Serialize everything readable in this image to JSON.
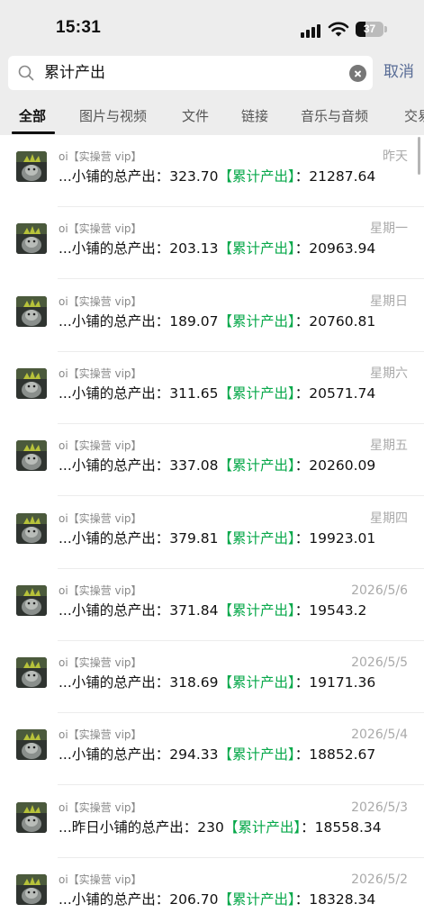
{
  "status_bar": {
    "time": "15:31",
    "battery": "37",
    "battery_level": 0.37
  },
  "search": {
    "query": "累计产出",
    "cancel_label": "取消"
  },
  "tabs": [
    {
      "label": "全部",
      "active": true
    },
    {
      "label": "图片与视频"
    },
    {
      "label": "文件"
    },
    {
      "label": "链接"
    },
    {
      "label": "音乐与音频"
    },
    {
      "label": "交易"
    }
  ],
  "results": [
    {
      "sender": "oi【实操营 vip】",
      "date": "昨天",
      "prefix": "...小铺的总产出：323.70",
      "highlight": "【累计产出】",
      "suffix": "：21287.64"
    },
    {
      "sender": "oi【实操营 vip】",
      "date": "星期一",
      "prefix": "...小铺的总产出：203.13",
      "highlight": "【累计产出】",
      "suffix": "：20963.94"
    },
    {
      "sender": "oi【实操营 vip】",
      "date": "星期日",
      "prefix": "...小铺的总产出：189.07",
      "highlight": "【累计产出】",
      "suffix": "：20760.81"
    },
    {
      "sender": "oi【实操营 vip】",
      "date": "星期六",
      "prefix": "...小铺的总产出：311.65",
      "highlight": "【累计产出】",
      "suffix": "：20571.74"
    },
    {
      "sender": "oi【实操营 vip】",
      "date": "星期五",
      "prefix": "...小铺的总产出：337.08",
      "highlight": "【累计产出】",
      "suffix": "：20260.09"
    },
    {
      "sender": "oi【实操营 vip】",
      "date": "星期四",
      "prefix": "...小铺的总产出：379.81",
      "highlight": "【累计产出】",
      "suffix": "：19923.01"
    },
    {
      "sender": "oi【实操营 vip】",
      "date": "2026/5/6",
      "prefix": "...小铺的总产出：371.84",
      "highlight": "【累计产出】",
      "suffix": "：19543.2"
    },
    {
      "sender": "oi【实操营 vip】",
      "date": "2026/5/5",
      "prefix": "...小铺的总产出：318.69",
      "highlight": "【累计产出】",
      "suffix": "：19171.36"
    },
    {
      "sender": "oi【实操营 vip】",
      "date": "2026/5/4",
      "prefix": "...小铺的总产出：294.33",
      "highlight": "【累计产出】",
      "suffix": "：18852.67"
    },
    {
      "sender": "oi【实操营 vip】",
      "date": "2026/5/3",
      "prefix": "...昨日小铺的总产出：230",
      "highlight": "【累计产出】",
      "suffix": "：18558.34"
    },
    {
      "sender": "oi【实操营 vip】",
      "date": "2026/5/2",
      "prefix": "...小铺的总产出：206.70",
      "highlight": "【累计产出】",
      "suffix": "：18328.34"
    }
  ],
  "colors": {
    "highlight": "#07a84a",
    "cancel": "#576b95",
    "header_bg": "#ededed"
  }
}
